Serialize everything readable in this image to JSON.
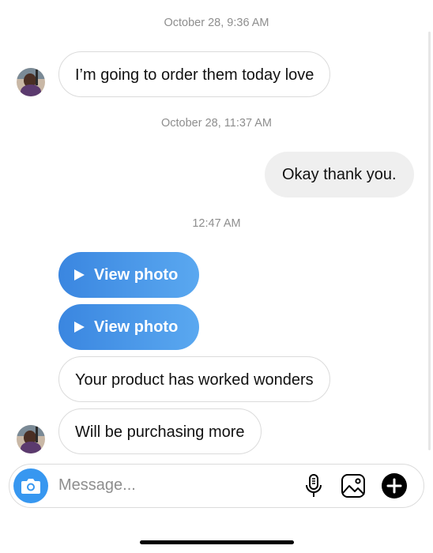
{
  "timestamps": [
    "October 28, 9:36 AM",
    "October 28, 11:37 AM",
    "12:47 AM"
  ],
  "messages": {
    "m1": "I’m going to order them today love",
    "m2": "Okay thank you.",
    "photo1": "View photo",
    "photo2": "View photo",
    "m3": "Your product has worked wonders",
    "m4": "Will be purchasing more"
  },
  "composer": {
    "placeholder": "Message...",
    "icons": [
      "camera-icon",
      "microphone-icon",
      "gallery-icon",
      "plus-icon"
    ]
  },
  "colors": {
    "photo_gradient_start": "#3a86e0",
    "photo_gradient_end": "#5aa8f0",
    "camera_button": "#3797f0",
    "timestamp": "#8e8e8e",
    "outgoing_bubble": "#efefef"
  }
}
